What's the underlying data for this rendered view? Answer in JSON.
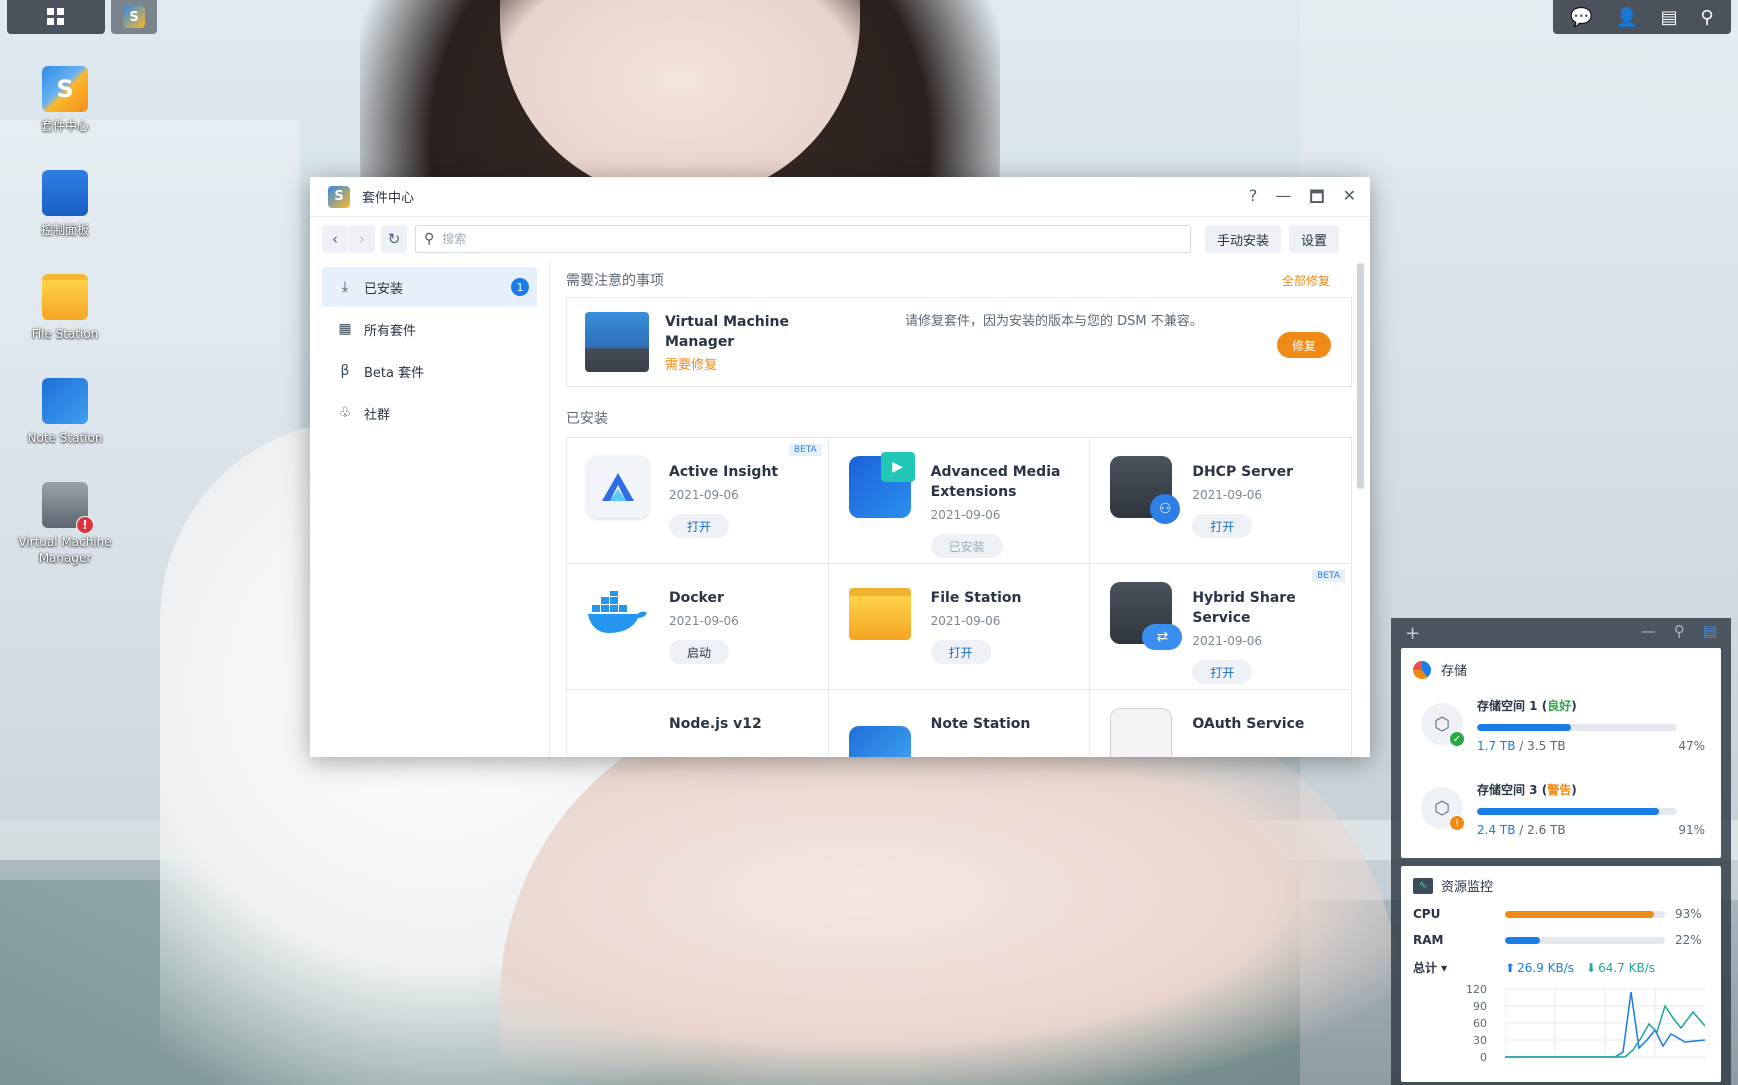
{
  "taskbar": {
    "right_icons": [
      "chat-icon",
      "user-icon",
      "widgets-icon",
      "search-icon"
    ]
  },
  "desktop": {
    "icons": [
      {
        "label": "套件中心"
      },
      {
        "label": "控制面板"
      },
      {
        "label": "File Station"
      },
      {
        "label": "Note Station"
      },
      {
        "label": "Virtual Machine Manager",
        "error": "!"
      }
    ]
  },
  "window": {
    "title": "套件中心",
    "controls": {
      "help": "?",
      "minimize": "—",
      "maximize": "🗖",
      "close": "✕"
    },
    "search_placeholder": "搜索",
    "manual_install": "手动安装",
    "settings": "设置"
  },
  "sidebar": {
    "items": [
      {
        "label": "已安装",
        "badge": "1",
        "icon": "download-icon"
      },
      {
        "label": "所有套件",
        "icon": "grid-icon"
      },
      {
        "label": "Beta 套件",
        "icon": "beta-icon"
      },
      {
        "label": "社群",
        "icon": "community-icon"
      }
    ]
  },
  "attention": {
    "heading": "需要注意的事项",
    "fix_all": "全部修复",
    "item": {
      "name": "Virtual Machine Manager",
      "status": "需要修复",
      "message": "请修复套件，因为安装的版本与您的 DSM 不兼容。",
      "button": "修复"
    }
  },
  "installed": {
    "heading": "已安装",
    "packages": [
      {
        "name": "Active Insight",
        "date": "2021-09-06",
        "action": "打开",
        "beta": "BETA"
      },
      {
        "name": "Advanced Media Extensions",
        "date": "2021-09-06",
        "action": "已安装"
      },
      {
        "name": "DHCP Server",
        "date": "2021-09-06",
        "action": "打开"
      },
      {
        "name": "Docker",
        "date": "2021-09-06",
        "action": "启动"
      },
      {
        "name": "File Station",
        "date": "2021-09-06",
        "action": "打开"
      },
      {
        "name": "Hybrid Share Service",
        "date": "2021-09-06",
        "action": "打开",
        "beta": "BETA"
      },
      {
        "name": "Node.js v12"
      },
      {
        "name": "Note Station"
      },
      {
        "name": "OAuth Service"
      }
    ]
  },
  "widget": {
    "storage": {
      "title": "存储",
      "volumes": [
        {
          "name": "存储空间 1",
          "status": "良好",
          "used": "1.7 TB",
          "total": "3.5 TB",
          "percent": "47%",
          "fill": 47
        },
        {
          "name": "存储空间 3",
          "status": "警告",
          "used": "2.4 TB",
          "total": "2.6 TB",
          "percent": "91%",
          "fill": 91
        }
      ]
    },
    "monitor": {
      "title": "资源监控",
      "cpu_label": "CPU",
      "cpu_percent": "93%",
      "cpu_fill": 93,
      "ram_label": "RAM",
      "ram_percent": "22%",
      "ram_fill": 22,
      "net_label": "总计 ▾",
      "upload": "26.9 KB/s",
      "download": "64.7 KB/s",
      "chart_ticks": [
        "120",
        "90",
        "60",
        "30",
        "0"
      ]
    }
  }
}
